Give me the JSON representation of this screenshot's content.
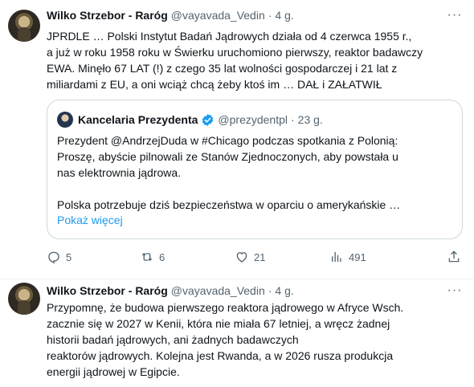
{
  "tweets": [
    {
      "author_name": "Wilko Strzebor - Raróg",
      "handle": "@vayavada_Vedin",
      "separator": "·",
      "time": "4 g.",
      "more_label": "···",
      "text": "JPRDLE … Polski Instytut Badań Jądrowych działa od 4 czerwca 1955 r.,\na już w roku 1958 roku w Świerku uruchomiono pierwszy, reaktor badawczy\nEWA. Minęło 67 LAT (!) z czego 35 lat wolności gospodarczej i 21 lat z\nmiliardami z EU, a oni wciąż chcą żeby ktoś im … DAŁ i ZAŁATWIŁ",
      "quote": {
        "author_name": "Kancelaria Prezydenta",
        "handle": "@prezydentpl",
        "separator": "·",
        "time": "23 g.",
        "text": "Prezydent @AndrzejDuda w #Chicago podczas spotkania z Polonią:\nProszę, abyście pilnowali ze Stanów Zjednoczonych, aby powstała u\nnas elektrownia jądrowa.\n\nPolska potrzebuje dziś bezpieczeństwa w oparciu o amerykańskie …",
        "show_more": "Pokaż więcej"
      },
      "stats": {
        "replies": "5",
        "retweets": "6",
        "likes": "21",
        "views": "491"
      }
    },
    {
      "author_name": "Wilko Strzebor - Raróg",
      "handle": "@vayavada_Vedin",
      "separator": "·",
      "time": "4 g.",
      "more_label": "···",
      "text": "Przypomnę, że budowa pierwszego reaktora jądrowego w Afryce Wsch.\nzacznie się w 2027 w Kenii, która nie miała 67 letniej, a wręcz żadnej\nhistorii badań jądrowych, ani żadnych badawczych\nreaktorów jądrowych. Kolejna jest Rwanda, a w 2026 rusza produkcja\nenergii jądrowej w Egipcie."
    }
  ],
  "colors": {
    "link": "#1d9bf0",
    "secondary_text": "#536471",
    "border": "#cfd9de"
  }
}
